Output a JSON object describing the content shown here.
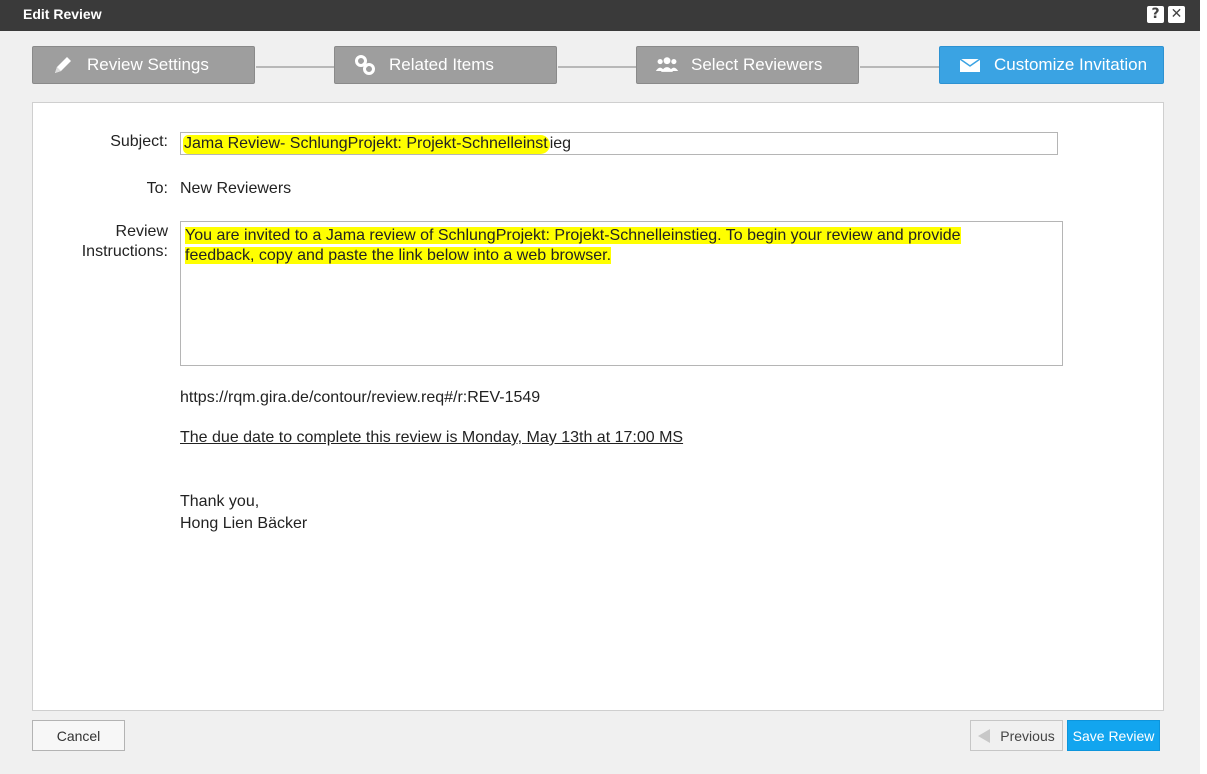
{
  "window": {
    "title": "Edit Review",
    "help_glyph": "?",
    "close_glyph": "✕"
  },
  "steps": [
    {
      "label": "Review Settings",
      "icon": "pencil-icon",
      "active": false
    },
    {
      "label": "Related Items",
      "icon": "link-icon",
      "active": false
    },
    {
      "label": "Select Reviewers",
      "icon": "users-icon",
      "active": false
    },
    {
      "label": "Customize Invitation",
      "icon": "envelope-icon",
      "active": true
    }
  ],
  "form": {
    "subject_label": "Subject:",
    "subject_value": "Jama Review-  SchlungProjekt:  Projekt-Schnelleinstieg",
    "subject_highlight": "Jama Review-  SchlungProjekt:  Projekt-Schnelleinst",
    "subject_rest": "ieg",
    "to_label": "To:",
    "to_value": "New Reviewers",
    "instructions_label_1": "Review",
    "instructions_label_2": "Instructions:",
    "instructions_line1": "You are invited to a Jama review of SchlungProjekt:  Projekt-Schnelleinstieg. To begin your review and provide",
    "instructions_line2": "feedback, copy and paste the link below into a web browser."
  },
  "body": {
    "link": "https://rqm.gira.de/contour/review.req#/r:REV-1549",
    "due_text": "The due date to complete this review is Monday, May 13th at 17:00 MS",
    "thanks": "Thank you,",
    "signature": "Hong Lien Bäcker"
  },
  "footer": {
    "cancel_label": "Cancel",
    "previous_label": "Previous",
    "save_label": "Save Review"
  },
  "colors": {
    "active_step": "#3aa3e3",
    "inactive_step": "#9e9e9e",
    "highlight": "#ffff00",
    "save_button": "#12a5ef"
  }
}
